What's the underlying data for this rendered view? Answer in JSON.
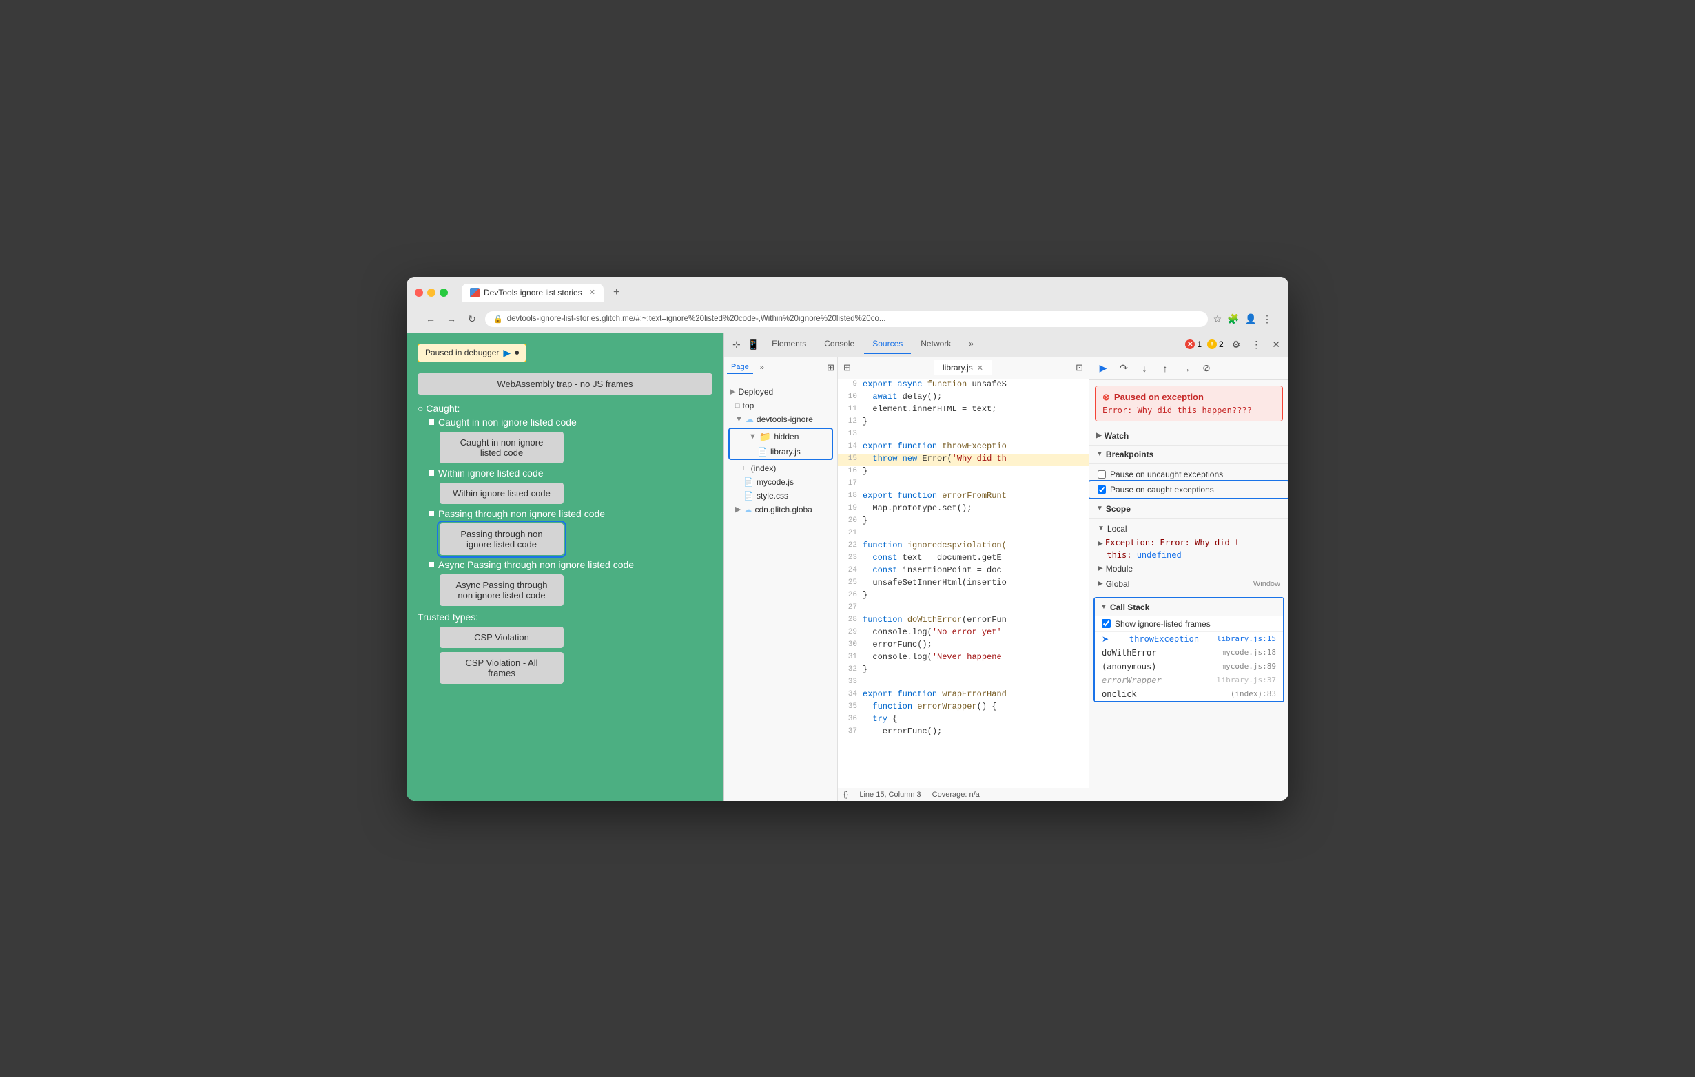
{
  "browser": {
    "tab_title": "DevTools ignore list stories",
    "tab_favicon": "🔵",
    "new_tab_btn": "+",
    "address": "devtools-ignore-list-stories.glitch.me/#:~:text=ignore%20listed%20code-,Within%20ignore%20listed%20co...",
    "nav_back": "←",
    "nav_forward": "→",
    "nav_refresh": "↻",
    "lock_icon": "🔒"
  },
  "webpage": {
    "paused_badge": "Paused in debugger",
    "webassembly_section": "WebAssembly trap - no JS frames",
    "caught_section": "Caught:",
    "caught_items": [
      {
        "label": "Caught in non ignore listed code",
        "button": "Caught in non ignore listed code"
      },
      {
        "label": "Within ignore listed code",
        "button": "Within ignore listed code"
      },
      {
        "label": "Passing through non ignore listed code",
        "button": "Passing through non ignore listed code",
        "active": true
      },
      {
        "label": "Async Passing through non ignore listed code",
        "button": "Async Passing through non ignore listed code"
      }
    ],
    "trusted_types_section": "Trusted types:",
    "csp_violation": "CSP Violation",
    "csp_violation_all": "CSP Violation - All frames"
  },
  "devtools": {
    "tabs": [
      "Elements",
      "Console",
      "Sources",
      "Network"
    ],
    "active_tab": "Sources",
    "error_count": "1",
    "warning_count": "2",
    "sources_subtabs": [
      "Page",
      ">>"
    ],
    "active_subtab": "Page"
  },
  "file_tree": {
    "deployed": "Deployed",
    "items": [
      {
        "name": "top",
        "type": "folder",
        "indent": 1
      },
      {
        "name": "devtools-ignore",
        "type": "cloud-folder",
        "indent": 1
      },
      {
        "name": "hidden",
        "type": "folder",
        "indent": 2,
        "selected": true
      },
      {
        "name": "library.js",
        "type": "file-red",
        "indent": 3,
        "selected": true
      },
      {
        "name": "(index)",
        "type": "file",
        "indent": 2
      },
      {
        "name": "mycode.js",
        "type": "file-red",
        "indent": 2
      },
      {
        "name": "style.css",
        "type": "file-orange",
        "indent": 2
      },
      {
        "name": "cdn.glitch.globa",
        "type": "cloud-folder",
        "indent": 1
      }
    ]
  },
  "editor": {
    "active_file": "library.js",
    "lines": [
      {
        "num": 9,
        "content": "export async function unsafeS"
      },
      {
        "num": 10,
        "content": "  await delay();"
      },
      {
        "num": 11,
        "content": "  element.innerHTML = text;"
      },
      {
        "num": 12,
        "content": "}"
      },
      {
        "num": 13,
        "content": ""
      },
      {
        "num": 14,
        "content": "export function throwExceptio",
        "type": "kw"
      },
      {
        "num": 15,
        "content": "  throw new Error('Why did th",
        "highlighted": true
      },
      {
        "num": 16,
        "content": "}"
      },
      {
        "num": 17,
        "content": ""
      },
      {
        "num": 18,
        "content": "export function errorFromRunt"
      },
      {
        "num": 19,
        "content": "  Map.prototype.set();"
      },
      {
        "num": 20,
        "content": "}"
      },
      {
        "num": 21,
        "content": ""
      },
      {
        "num": 22,
        "content": "function ignoredcspviolation("
      },
      {
        "num": 23,
        "content": "  const text = document.getE"
      },
      {
        "num": 24,
        "content": "  const insertionPoint = doc"
      },
      {
        "num": 25,
        "content": "  unsafeSetInnerHtml(insertio"
      },
      {
        "num": 26,
        "content": "}"
      },
      {
        "num": 27,
        "content": ""
      },
      {
        "num": 28,
        "content": "function doWithError(errorFun"
      },
      {
        "num": 29,
        "content": "  console.log('No error yet'"
      },
      {
        "num": 30,
        "content": "  errorFunc();"
      },
      {
        "num": 31,
        "content": "  console.log('Never happene"
      },
      {
        "num": 32,
        "content": "}"
      },
      {
        "num": 33,
        "content": ""
      },
      {
        "num": 34,
        "content": "export function wrapErrorHand"
      },
      {
        "num": 35,
        "content": "  function errorWrapper() {"
      },
      {
        "num": 36,
        "content": "  try {"
      },
      {
        "num": 37,
        "content": "    errorFunc();"
      }
    ],
    "status_line": "Line 15, Column 3",
    "status_coverage": "Coverage: n/a"
  },
  "debugger": {
    "exception": {
      "title": "Paused on exception",
      "message": "Error: Why did this happen????"
    },
    "sections": {
      "watch": "Watch",
      "breakpoints": "Breakpoints",
      "scope": "Scope",
      "local": "Local",
      "module": "Module",
      "global": "Global",
      "call_stack": "Call Stack"
    },
    "breakpoints": {
      "pause_uncaught": "Pause on uncaught exceptions",
      "pause_caught": "Pause on caught exceptions",
      "pause_caught_checked": true,
      "pause_uncaught_checked": false
    },
    "scope_local": {
      "exception_key": "Exception:",
      "exception_val": "Error: Why did t",
      "this_key": "this:",
      "this_val": "undefined"
    },
    "global_label": "Window",
    "call_stack": {
      "show_ignore_listed": "Show ignore-listed frames",
      "show_ignore_checked": true,
      "frames": [
        {
          "name": "throwException",
          "location": "library.js:15",
          "active": true,
          "dimmed": false
        },
        {
          "name": "doWithError",
          "location": "mycode.js:18",
          "active": false,
          "dimmed": false
        },
        {
          "name": "(anonymous)",
          "location": "mycode.js:89",
          "active": false,
          "dimmed": false
        },
        {
          "name": "errorWrapper",
          "location": "library.js:37",
          "active": false,
          "dimmed": true
        },
        {
          "name": "onclick",
          "location": "(index):83",
          "active": false,
          "dimmed": false
        }
      ]
    }
  }
}
